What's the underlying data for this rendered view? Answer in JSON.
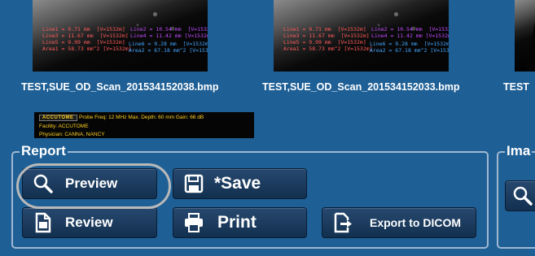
{
  "thumbnails": [
    {
      "caption": "TEST,SUE_OD_Scan_201534152038.bmp",
      "meas": "Line1 = 9.71 mm  [V=1532m]\nLine3 = 11.67 mm  [V=1532m]\nLine5 = 9.99 mm  [V=1532m]\nArea1 = 58.73 mm^2 [V=1532m]",
      "meas2": "Line2 = 10.54 mm  [V=1532m]\nLine4 = 11.42 mm [V=1532m]",
      "meas4": "Line6 = 9.28 mm  [V=1532m]\nArea2 = 67.18 mm^2 [V=1532m]"
    },
    {
      "caption": "TEST,SUE_OD_Scan_201534152033.bmp",
      "meas": "Line1 = 9.71 mm  [V=1532m]\nLine3 = 11.67 mm  [V=1532m]\nLine5 = 9.99 mm  [V=1532m]\nArea1 = 58.73 mm^2 [V=1532m]",
      "meas2": "Line2 = 10.54 mm  [V=1532m]\nLine4 = 11.42 mm [V=1532m]",
      "meas4": "Line6 = 9.28 mm  [V=1532m]\nArea2 = 67.18 mm^2 [V=1532m]"
    },
    {
      "caption": "TEST"
    }
  ],
  "mini_thumb": {
    "logo": "ACCUTOME",
    "line1": "Probe Freq: 12 MHz   Max. Depth: 60 mm   Gain: 66 dB",
    "line2": "Facility: ACCUTOME",
    "line3": "Physician: CANNA, NANCY"
  },
  "report": {
    "title": "Report",
    "buttons": {
      "preview": "Preview",
      "save": "*Save",
      "review": "Review",
      "print": "Print",
      "export": "Export to DICOM"
    }
  },
  "image_group": {
    "title": "Ima"
  },
  "colors": {
    "background": "#1e5f95",
    "button": "#1c3b5e",
    "group_border": "#9fb8d2",
    "highlight_ring": "#b9b9b9"
  }
}
